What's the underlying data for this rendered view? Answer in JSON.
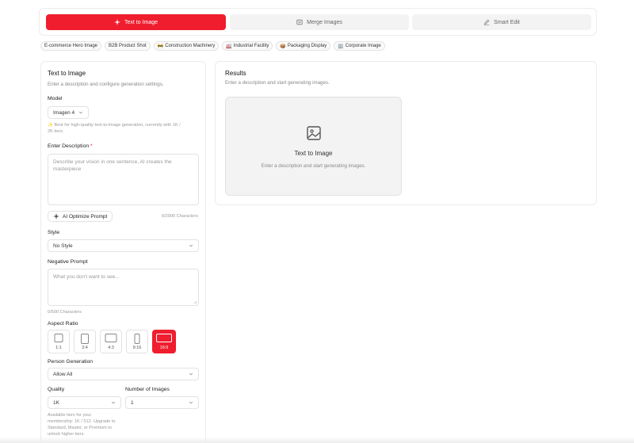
{
  "tabs": [
    {
      "label": "Text to Image",
      "icon": "sparkle-icon",
      "active": true
    },
    {
      "label": "Merge Images",
      "icon": "merge-icon",
      "active": false
    },
    {
      "label": "Smart Edit",
      "icon": "pencil-icon",
      "active": false
    }
  ],
  "chips": [
    {
      "label": "E-commerce Hero Image",
      "icon": ""
    },
    {
      "label": "B2B Product Shot",
      "icon": ""
    },
    {
      "label": "Construction Machinery",
      "icon": "🚧"
    },
    {
      "label": "Industrial Facility",
      "icon": "🏭"
    },
    {
      "label": "Packaging Display",
      "icon": "📦"
    },
    {
      "label": "Corporate Image",
      "icon": "🏢"
    }
  ],
  "left": {
    "title": "Text to Image",
    "subtitle": "Enter a description and configure generation settings.",
    "model_label": "Model",
    "model_value": "Imagen 4",
    "model_hint_1": "✨ Best for high-quality text-to-image generation, currently with 1K /",
    "model_hint_2": "2K tiers.",
    "desc_label": "Enter Description",
    "desc_required": "*",
    "desc_placeholder": "Describe your vision in one sentence, AI creates the masterpiece",
    "optimize_label": "AI Optimize Prompt",
    "desc_counter": "0/2000 Characters",
    "style_label": "Style",
    "style_value": "No Style",
    "neg_label": "Negative Prompt",
    "neg_placeholder": "What you don't want to see...",
    "neg_counter": "0/500 Characters",
    "aspect_label": "Aspect Ratio",
    "aspects": [
      {
        "label": "1:1",
        "active": false
      },
      {
        "label": "3:4",
        "active": false
      },
      {
        "label": "4:3",
        "active": false
      },
      {
        "label": "9:16",
        "active": false
      },
      {
        "label": "16:9",
        "active": true
      }
    ],
    "person_label": "Person Generation",
    "person_value": "Allow All",
    "quality_label": "Quality",
    "quality_value": "1K",
    "num_label": "Number of Images",
    "num_value": "1",
    "tier_hint_1": "Available tiers for your",
    "tier_hint_2": "membership: 1K / 512. Upgrade to",
    "tier_hint_3": "Standard, Master, or Premium to",
    "tier_hint_4": "unlock higher tiers."
  },
  "results": {
    "title": "Results",
    "subtitle": "Enter a description and start generating images.",
    "placeholder_title": "Text to Image",
    "placeholder_sub": "Enter a description and start generating images."
  },
  "colors": {
    "accent": "#ef1d2e"
  }
}
